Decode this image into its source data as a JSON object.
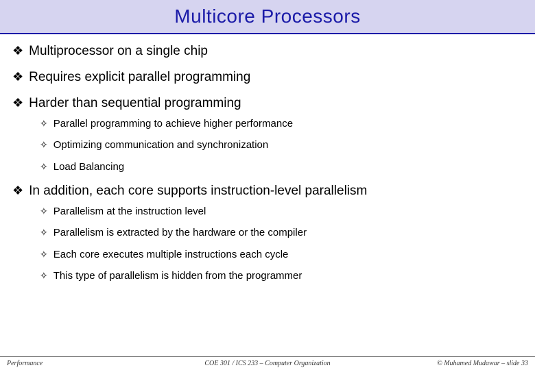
{
  "title": "Multicore Processors",
  "bullets": [
    {
      "text": "Multiprocessor on a single chip"
    },
    {
      "text": "Requires explicit parallel programming"
    },
    {
      "text": "Harder than sequential programming",
      "sub": [
        "Parallel programming to achieve higher performance",
        "Optimizing communication and synchronization",
        "Load Balancing"
      ]
    },
    {
      "text": "In addition, each core supports instruction-level parallelism",
      "sub": [
        "Parallelism at the instruction level",
        "Parallelism is extracted by the hardware or the compiler",
        "Each core executes multiple instructions each cycle",
        "This type of parallelism is hidden from the programmer"
      ]
    }
  ],
  "footer": {
    "left": "Performance",
    "center": "COE 301 / ICS 233 – Computer Organization",
    "right": "© Muhamed Mudawar – slide 33"
  }
}
